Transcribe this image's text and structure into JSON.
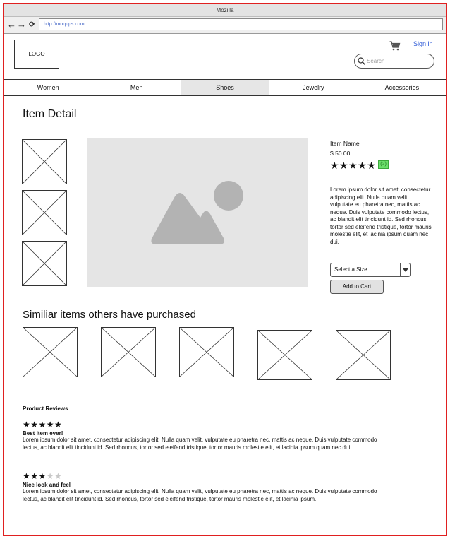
{
  "browser": {
    "title": "Mozilla",
    "url": "http://moqups.com",
    "nav": {
      "back": "←",
      "forward": "→",
      "reload": "⟳"
    }
  },
  "header": {
    "logo": "LOGO",
    "signin": "Sign in",
    "search_placeholder": "Search",
    "icons": [
      "cart-icon",
      "search-icon"
    ]
  },
  "menu": {
    "items": [
      "Women",
      "Men",
      "Shoes",
      "Jewelry",
      "Accessories"
    ],
    "active": "Shoes"
  },
  "page": {
    "title": "Item Detail"
  },
  "product": {
    "name": "Item Name",
    "price": "$ 50.00",
    "rating": 5,
    "review_count": "(2)",
    "description": "Lorem ipsum dolor sit amet, consectetur adipiscing elit. Nulla quam velit, vulputate eu pharetra nec, mattis ac neque. Duis vulputate commodo lectus, ac blandit elit tincidunt id. Sed rhoncus, tortor sed eleifend tristique, tortor mauris molestie elit, et lacinia ipsum quam nec dui.",
    "size_select": "Select a Size",
    "add_to_cart": "Add to Cart"
  },
  "similar": {
    "title": "Similiar items others have purchased"
  },
  "reviews": {
    "title": "Product Reviews",
    "items": [
      {
        "stars": 5,
        "title": "Best item ever!",
        "body": "Lorem ipsum dolor sit amet, consectetur adipiscing elit. Nulla quam velit, vulputate eu pharetra nec, mattis ac neque. Duis vulputate commodo lectus, ac blandit elit tincidunt id. Sed rhoncus, tortor sed eleifend tristique, tortor mauris molestie elit, et lacinia ipsum quam nec dui."
      },
      {
        "stars": 3,
        "title": "Nice look and feel",
        "body": "Lorem ipsum dolor sit amet, consectetur adipiscing elit. Nulla quam velit, vulputate eu pharetra nec, mattis ac neque. Duis vulputate commodo lectus, ac blandit elit tincidunt id. Sed rhoncus, tortor sed eleifend tristique, tortor mauris molestie elit, et lacinia ipsum."
      }
    ]
  },
  "colors": {
    "frame": "#e02020",
    "link": "#2a57d6",
    "badge": "#6be06b",
    "image_bg": "#e5e5e5"
  }
}
